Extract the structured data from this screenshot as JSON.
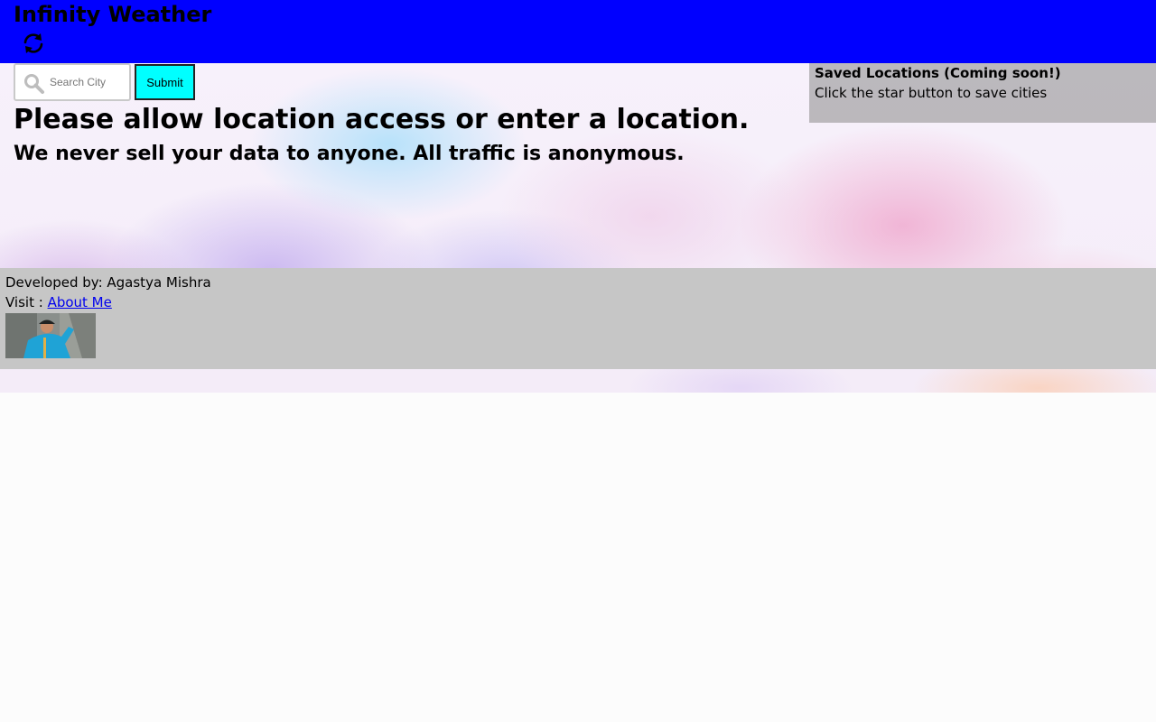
{
  "header": {
    "app_title": "Infinity Weather",
    "refresh_icon": "refresh-icon"
  },
  "search": {
    "icon": "search-icon",
    "placeholder": "Search City",
    "value": "",
    "submit_label": "Submit"
  },
  "main": {
    "title": "Please allow location access or enter a location.",
    "subtitle": "We never sell your data to anyone. All traffic is anonymous."
  },
  "saved_locations": {
    "title": "Saved Locations (Coming soon!)",
    "description": "Click the star button to save cities"
  },
  "footer": {
    "developer_text": "Developed by: Agastya Mishra",
    "visit_prefix": "Visit : ",
    "about_link": "About Me"
  },
  "colors": {
    "header_bg": "#0000ff",
    "submit_bg": "#00ffff",
    "footer_bg": "#c6c6c6",
    "link": "#0000ee"
  }
}
